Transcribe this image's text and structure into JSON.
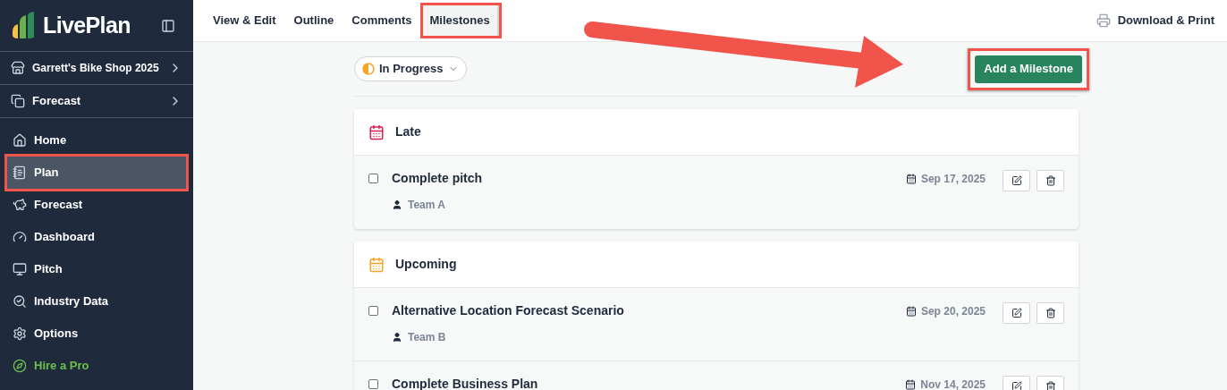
{
  "sidebar": {
    "logo": "LivePlan",
    "project": "Garrett's Bike Shop 2025",
    "section": "Forecast",
    "items": [
      {
        "label": "Home",
        "kind": "link",
        "selected": false,
        "highlighted": false
      },
      {
        "label": "Plan",
        "kind": "link",
        "selected": true,
        "highlighted": true
      },
      {
        "label": "Forecast",
        "kind": "link",
        "selected": false,
        "highlighted": false
      },
      {
        "label": "Dashboard",
        "kind": "link",
        "selected": false,
        "highlighted": false
      },
      {
        "label": "Pitch",
        "kind": "link",
        "selected": false,
        "highlighted": false
      },
      {
        "label": "Industry Data",
        "kind": "link",
        "selected": false,
        "highlighted": false
      },
      {
        "label": "Options",
        "kind": "link",
        "selected": false,
        "highlighted": false
      },
      {
        "label": "Hire a Pro",
        "kind": "promo",
        "selected": false,
        "highlighted": false
      }
    ]
  },
  "tabs": [
    {
      "label": "View & Edit",
      "selected": false,
      "highlighted": false
    },
    {
      "label": "Outline",
      "selected": false,
      "highlighted": false
    },
    {
      "label": "Comments",
      "selected": false,
      "highlighted": false
    },
    {
      "label": "Milestones",
      "selected": true,
      "highlighted": true
    }
  ],
  "download": "Download & Print",
  "filter": {
    "label": "In Progress"
  },
  "add_button": {
    "label": "Add a Milestone",
    "highlighted": true
  },
  "groups": [
    {
      "title": "Late",
      "color": "#d6204e",
      "milestones": [
        {
          "title": "Complete pitch",
          "team": "Team A",
          "date": "Sep 17, 2025",
          "checked": false
        }
      ]
    },
    {
      "title": "Upcoming",
      "color": "#f5a623",
      "milestones": [
        {
          "title": "Alternative Location Forecast Scenario",
          "team": "Team B",
          "date": "Sep 20, 2025",
          "checked": false
        },
        {
          "title": "Complete Business Plan",
          "date": "Nov 14, 2025",
          "checked": false
        }
      ]
    }
  ]
}
